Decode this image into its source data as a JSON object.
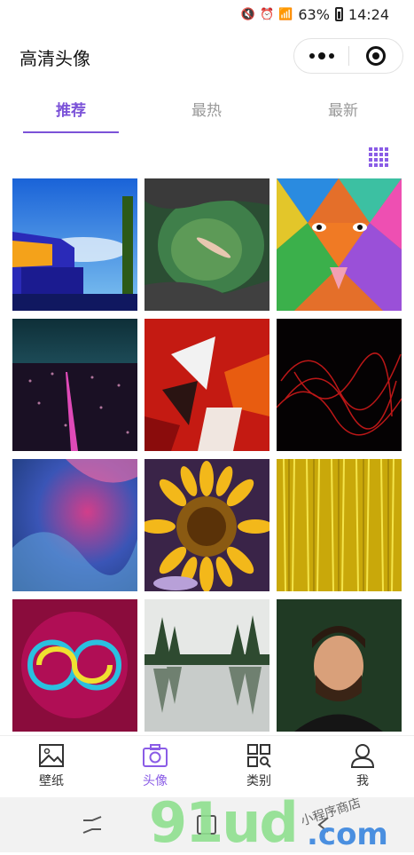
{
  "status": {
    "battery": "63%",
    "time": "14:24"
  },
  "header": {
    "title": "高清头像"
  },
  "tabs": [
    {
      "label": "推荐",
      "active": true
    },
    {
      "label": "最热",
      "active": false
    },
    {
      "label": "最新",
      "active": false
    }
  ],
  "accent_color": "#7b52d8",
  "gallery": {
    "images": [
      {
        "name": "blue-building"
      },
      {
        "name": "swimmer-lagoon"
      },
      {
        "name": "colorful-lion-mural"
      },
      {
        "name": "city-night-aerial"
      },
      {
        "name": "red-abstract-paint"
      },
      {
        "name": "red-light-trails"
      },
      {
        "name": "blue-pink-ink"
      },
      {
        "name": "sunflower"
      },
      {
        "name": "gold-tinsel"
      },
      {
        "name": "neon-infinity"
      },
      {
        "name": "lake-reflection"
      },
      {
        "name": "bearded-man-portrait"
      }
    ]
  },
  "tabbar": [
    {
      "label": "壁纸",
      "icon": "image-icon",
      "active": false
    },
    {
      "label": "头像",
      "icon": "camera-icon",
      "active": true
    },
    {
      "label": "类别",
      "icon": "category-icon",
      "active": false
    },
    {
      "label": "我",
      "icon": "user-icon",
      "active": false
    }
  ],
  "watermark": {
    "text": "91ud",
    "suffix": ".com",
    "cn": "小程序商店"
  }
}
